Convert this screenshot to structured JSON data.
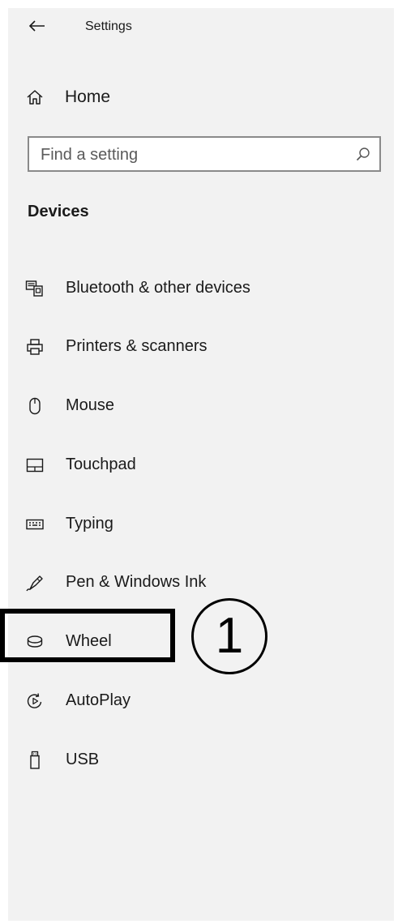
{
  "window": {
    "title": "Settings"
  },
  "home": {
    "label": "Home",
    "icon": "home-icon"
  },
  "search": {
    "placeholder": "Find a setting",
    "value": "",
    "icon": "search-icon"
  },
  "section": {
    "title": "Devices"
  },
  "nav": {
    "items": [
      {
        "label": "Bluetooth & other devices",
        "icon": "bluetooth-devices-icon"
      },
      {
        "label": "Printers & scanners",
        "icon": "printer-icon"
      },
      {
        "label": "Mouse",
        "icon": "mouse-icon"
      },
      {
        "label": "Touchpad",
        "icon": "touchpad-icon"
      },
      {
        "label": "Typing",
        "icon": "keyboard-icon"
      },
      {
        "label": "Pen & Windows Ink",
        "icon": "pen-icon"
      },
      {
        "label": "Wheel",
        "icon": "wheel-icon"
      },
      {
        "label": "AutoPlay",
        "icon": "autoplay-icon"
      },
      {
        "label": "USB",
        "icon": "usb-icon"
      }
    ]
  },
  "annotation": {
    "callout_number": "1",
    "highlighted_item": "Wheel"
  }
}
